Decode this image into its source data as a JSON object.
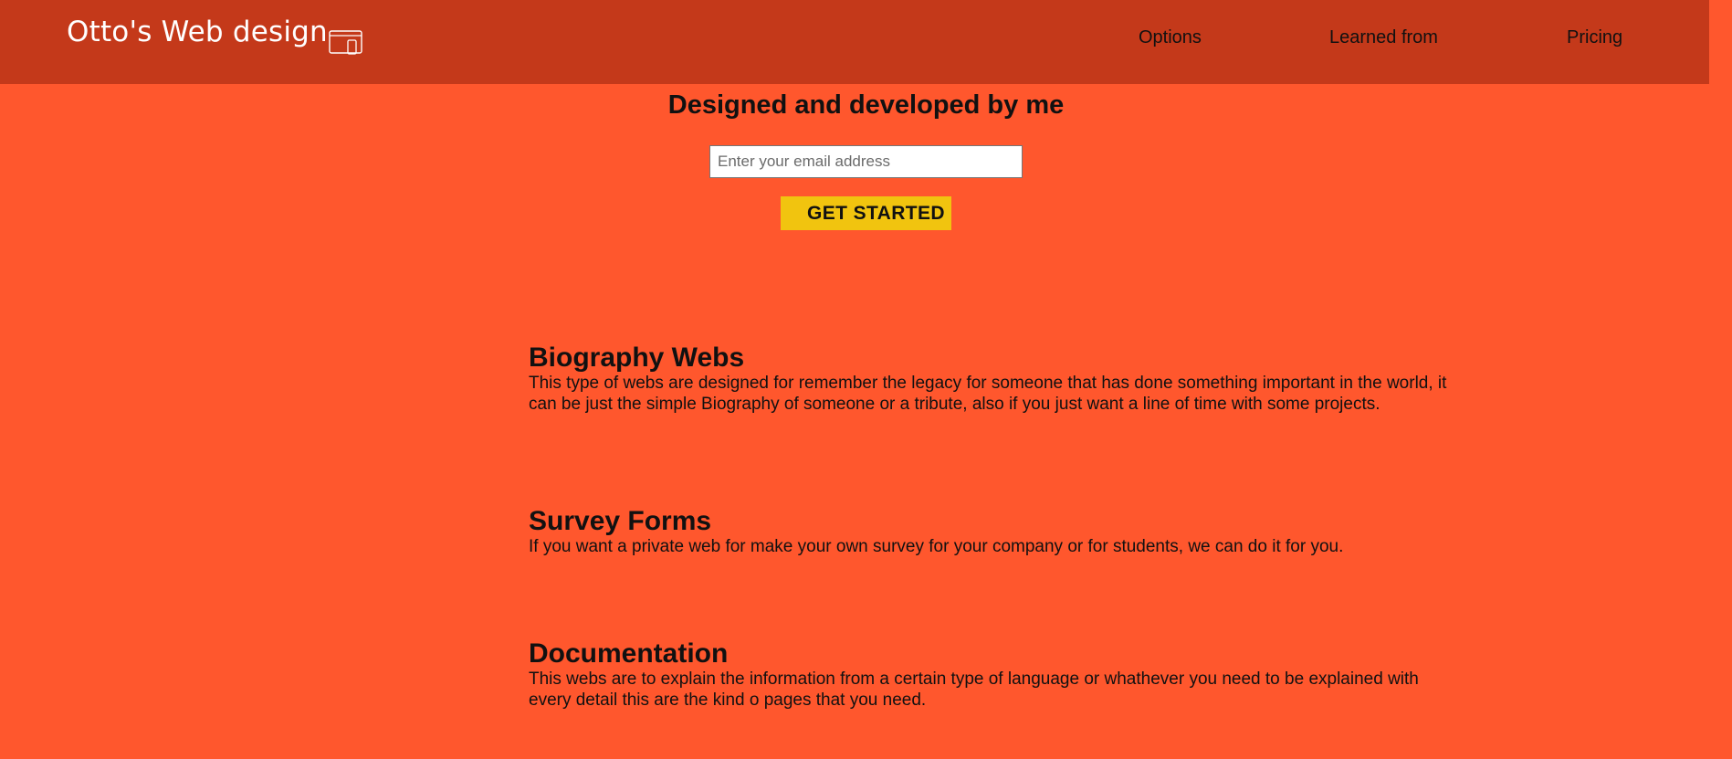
{
  "header": {
    "brand": "Otto's Web design",
    "brand_icon": "responsive-devices-icon",
    "nav": {
      "options": "Options",
      "learned_from": "Learned from",
      "pricing": "Pricing"
    }
  },
  "hero": {
    "title": "Designed and developed by me",
    "email_placeholder": "Enter your email address",
    "email_value": "",
    "cta_label": "GET STARTED"
  },
  "sections": [
    {
      "title": "Biography Webs",
      "text": "This type of webs are designed for remember the legacy for someone that has done something important in the world, it can be just the simple Biography of someone or a tribute, also if you just want a line of time with some projects."
    },
    {
      "title": "Survey Forms",
      "text": "If you want a private web for make your own survey for your company or for students, we can do it for you."
    },
    {
      "title": "Documentation",
      "text": "This webs are to explain the information from a certain type of language or whathever you need to be explained with every detail this are the kind o pages that you need."
    }
  ],
  "colors": {
    "page_background": "#ff572d",
    "header_background": "#c4391a",
    "button_background": "#f1c40f",
    "brand_text": "#ffffff"
  }
}
